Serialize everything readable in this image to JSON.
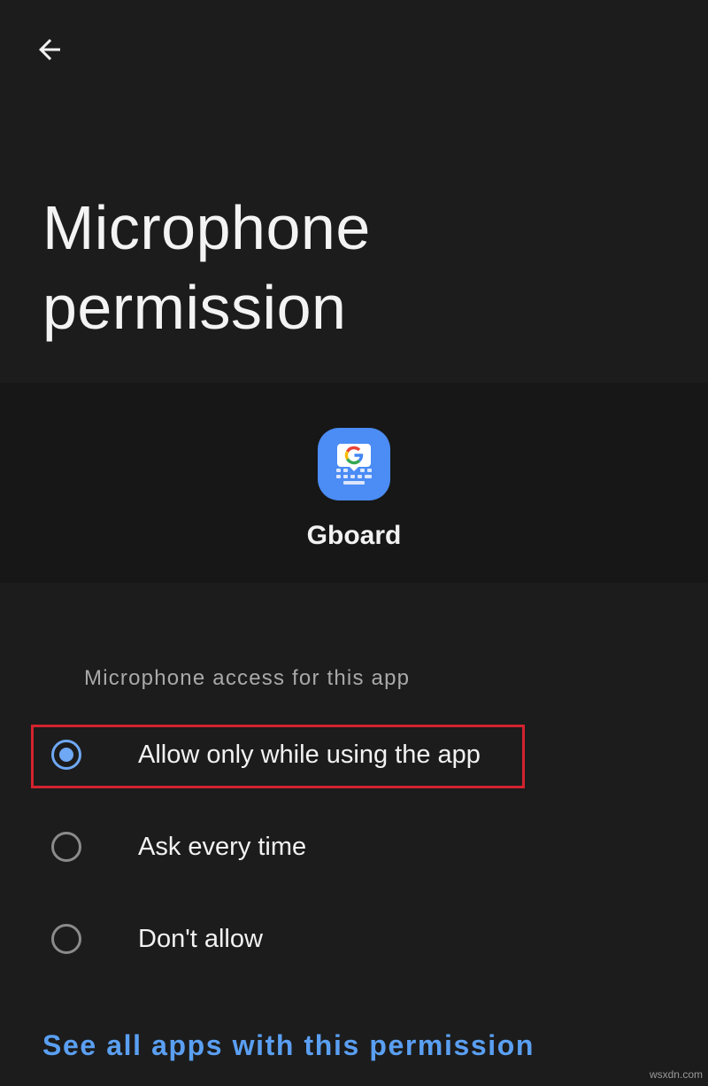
{
  "header": {
    "title": "Microphone permission",
    "back_icon": "arrow-back-icon"
  },
  "app": {
    "name": "Gboard",
    "icon": "gboard-icon"
  },
  "permission": {
    "section_label": "Microphone access for this app",
    "options": [
      {
        "label": "Allow only while using the app",
        "selected": true
      },
      {
        "label": "Ask every time",
        "selected": false
      },
      {
        "label": "Don't allow",
        "selected": false
      }
    ]
  },
  "footer": {
    "link_label": "See all apps with this permission"
  },
  "watermark": "wsxdn.com",
  "colors": {
    "background": "#1c1c1c",
    "accent": "#6fa8f5",
    "link": "#5a9ff2",
    "highlight": "#d3232f"
  }
}
